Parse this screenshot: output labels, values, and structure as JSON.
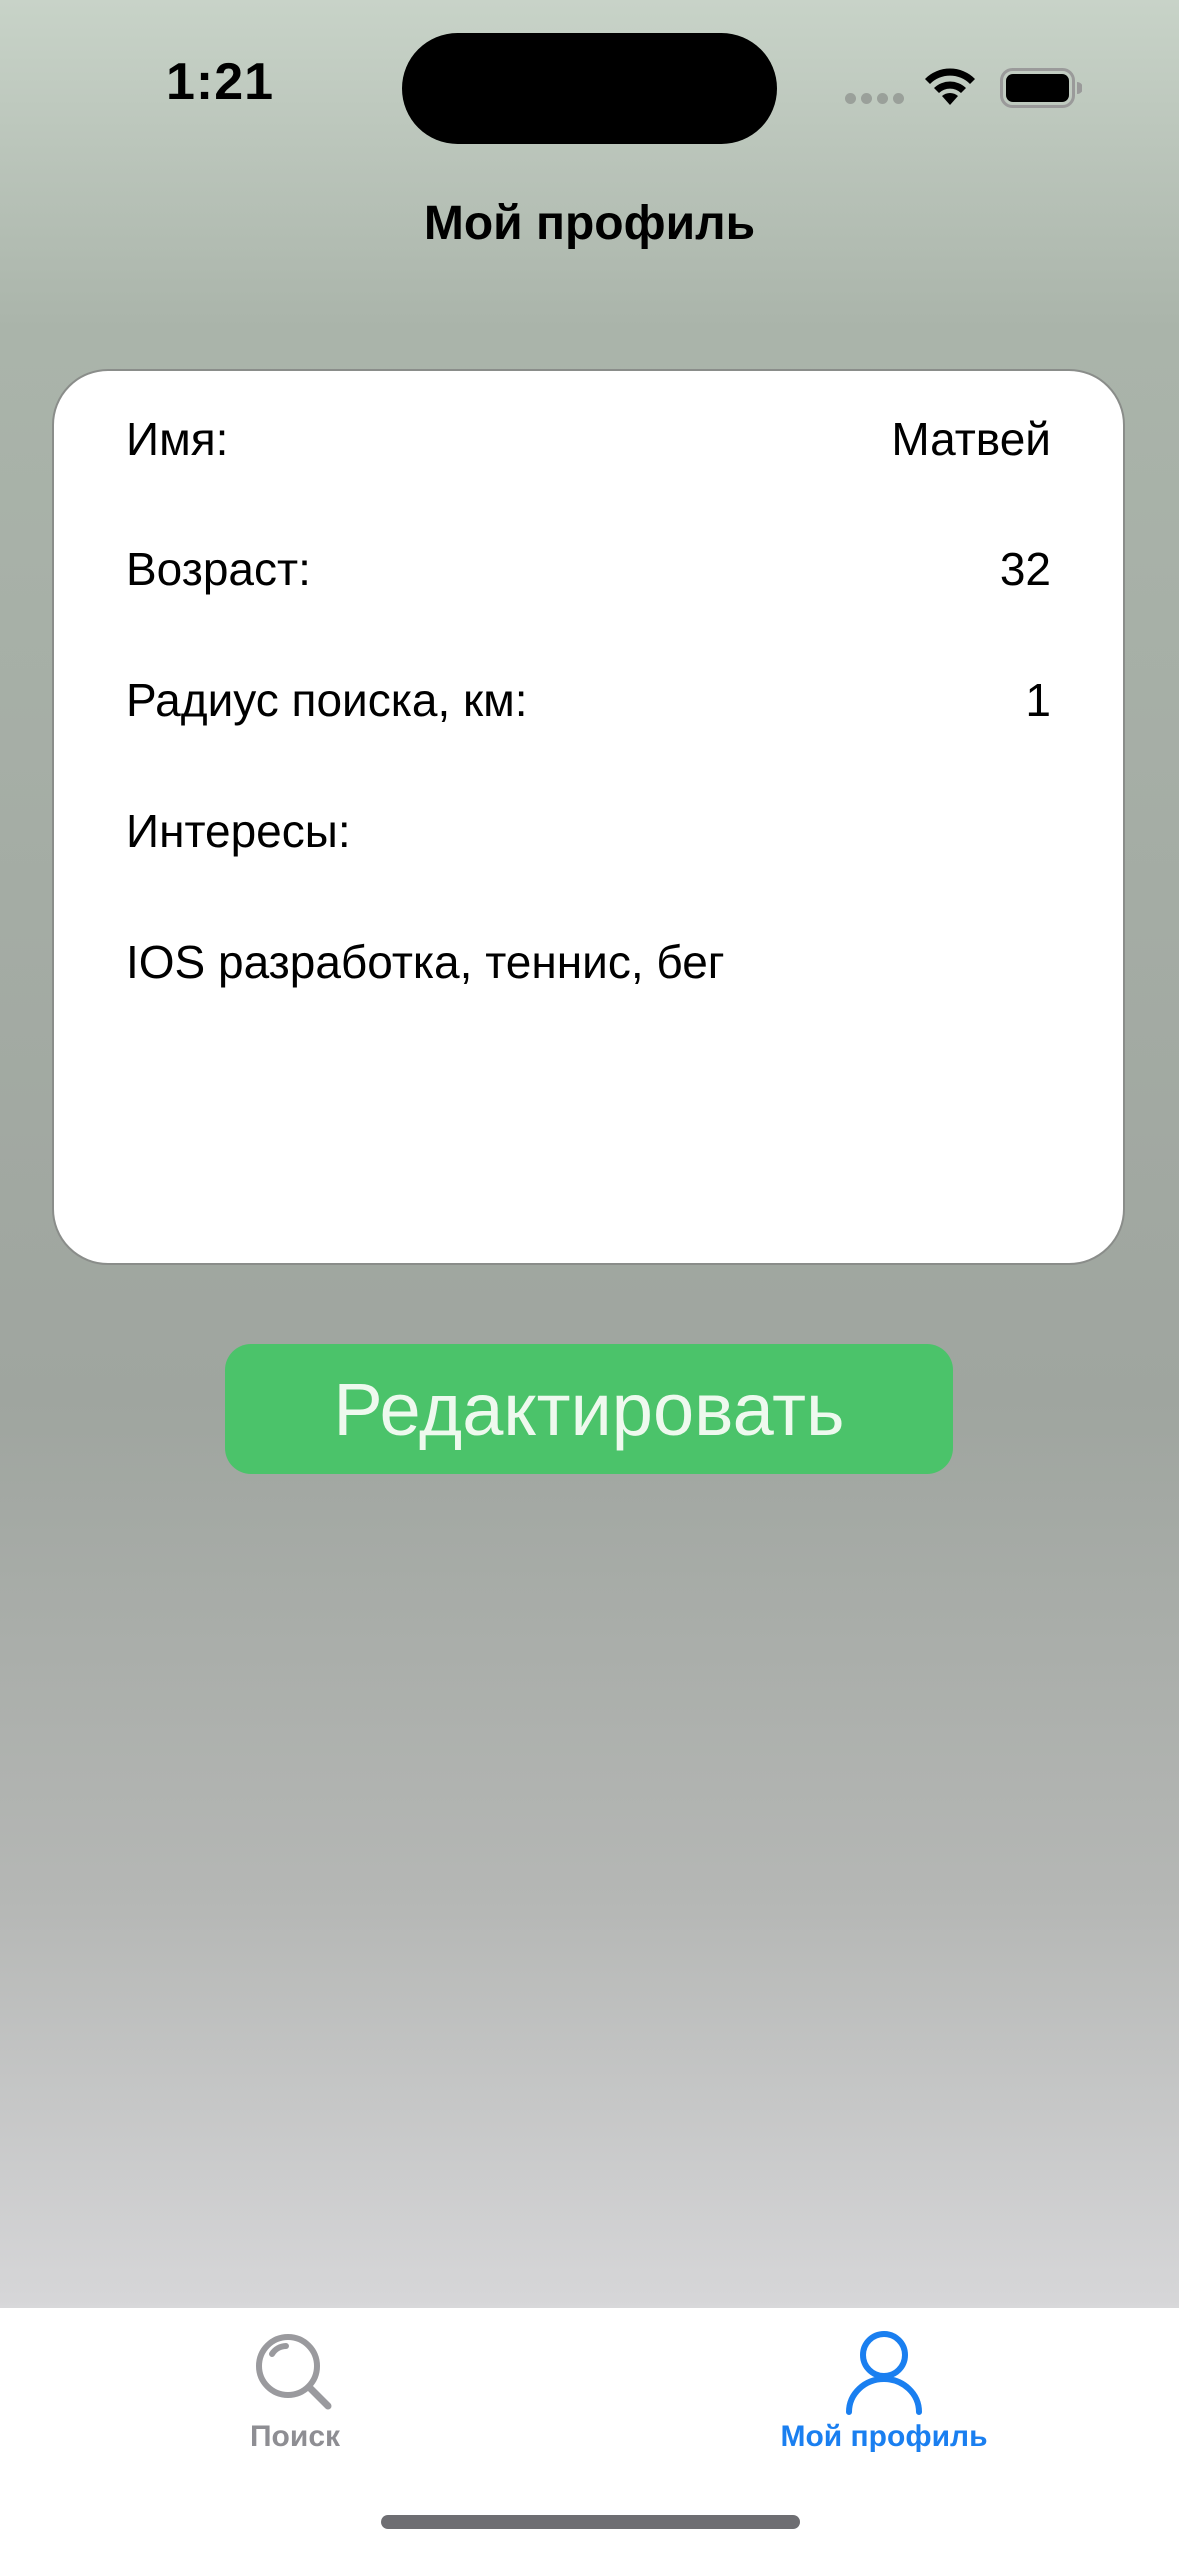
{
  "status_bar": {
    "time": "1:21"
  },
  "header": {
    "title": "Мой профиль"
  },
  "profile": {
    "name_label": "Имя:",
    "name_value": "Матвей",
    "age_label": "Возраст:",
    "age_value": "32",
    "radius_label": "Радиус поиска, км:",
    "radius_value": "1",
    "interests_label": "Интересы:",
    "interests_value": "IOS разработка, теннис, бег"
  },
  "edit_button": {
    "label": "Редактировать"
  },
  "tab_bar": {
    "tabs": [
      {
        "label": "Поиск",
        "icon": "search-icon",
        "active": false
      },
      {
        "label": "Мой профиль",
        "icon": "person-icon",
        "active": true
      }
    ]
  },
  "colors": {
    "accent": "#1a7ff0",
    "button": "#4bc36a",
    "inactive_tab": "#8e8e93"
  }
}
